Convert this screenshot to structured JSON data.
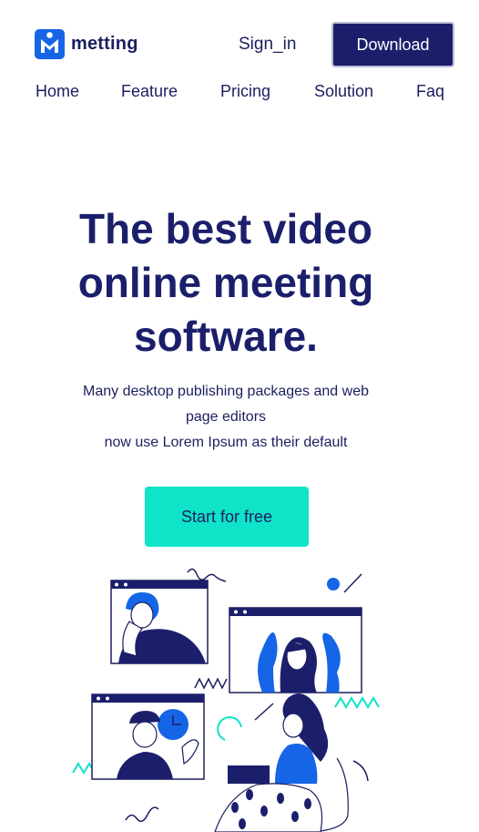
{
  "brand": {
    "name": "metting",
    "logo_icon": "metting-logo-icon",
    "accent": "#1565e6"
  },
  "header": {
    "signin_label": "Sign_in",
    "download_label": "Download",
    "download_color": "#1b1f6b"
  },
  "nav": {
    "items": [
      "Home",
      "Feature",
      "Pricing",
      "Solution",
      "Faq"
    ]
  },
  "hero": {
    "title_lines": [
      "The best video",
      "online meeting",
      "software."
    ],
    "subtitle_lines": [
      "Many desktop publishing packages and web",
      "page editors",
      "now use Lorem Ipsum as their default"
    ],
    "cta_label": "Start for free",
    "cta_color": "#0fe3c8"
  },
  "illustration": {
    "icon": "video-meeting-illustration"
  }
}
